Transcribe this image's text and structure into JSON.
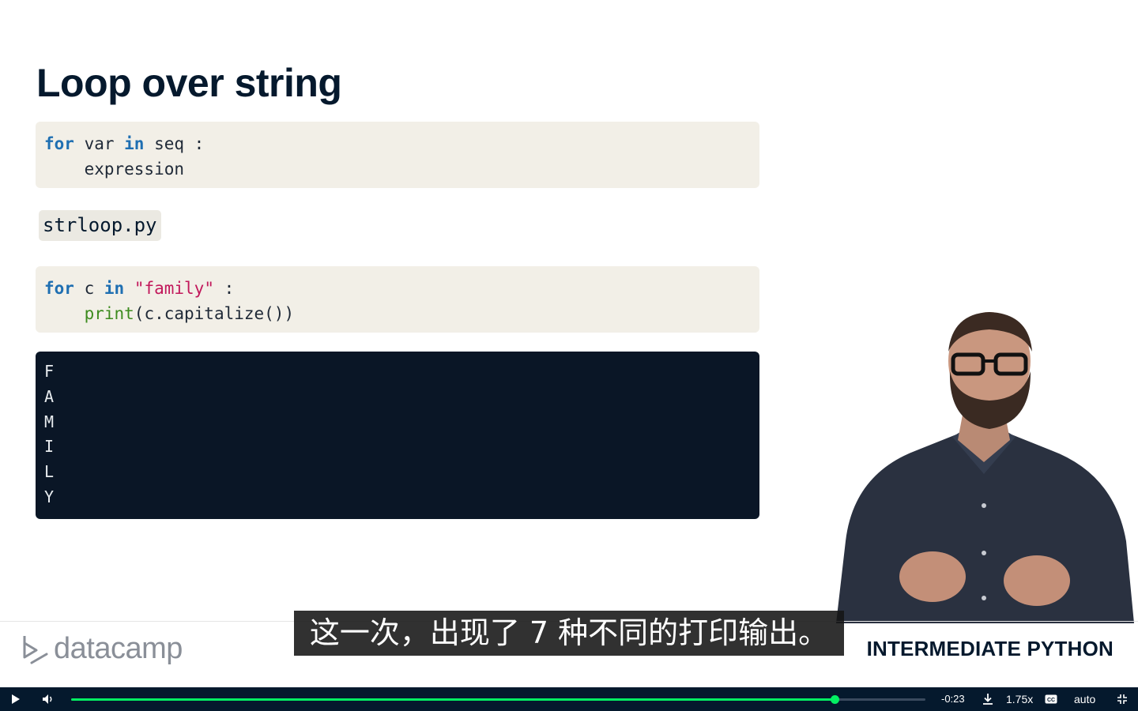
{
  "slide": {
    "title": "Loop over string",
    "syntax_block": {
      "line1": {
        "kw1": "for",
        "t1": " var ",
        "kw2": "in",
        "t2": " seq :"
      },
      "line2": {
        "indent": "    ",
        "text": "expression"
      }
    },
    "file_tag": "strloop.py",
    "code_block": {
      "line1": {
        "kw1": "for",
        "t1": " c ",
        "kw2": "in",
        "t2": " ",
        "str": "\"family\"",
        "t3": " :"
      },
      "line2": {
        "indent": "    ",
        "fn": "print",
        "rest": "(c.capitalize())"
      }
    },
    "output_lines": [
      "F",
      "A",
      "M",
      "I",
      "L",
      "Y"
    ]
  },
  "branding": {
    "logo_text": "datacamp",
    "course_name": "INTERMEDIATE PYTHON"
  },
  "subtitle": "这一次，出现了 7 种不同的打印输出。",
  "player": {
    "progress": 0.894,
    "time_remaining": "-0:23",
    "speed": "1.75x",
    "quality": "auto",
    "colors": {
      "accent": "#03ef62",
      "bar_bg": "#05192d"
    },
    "icons": [
      "play-icon",
      "volume-icon",
      "download-icon",
      "captions-icon",
      "exit-fullscreen-icon"
    ]
  }
}
